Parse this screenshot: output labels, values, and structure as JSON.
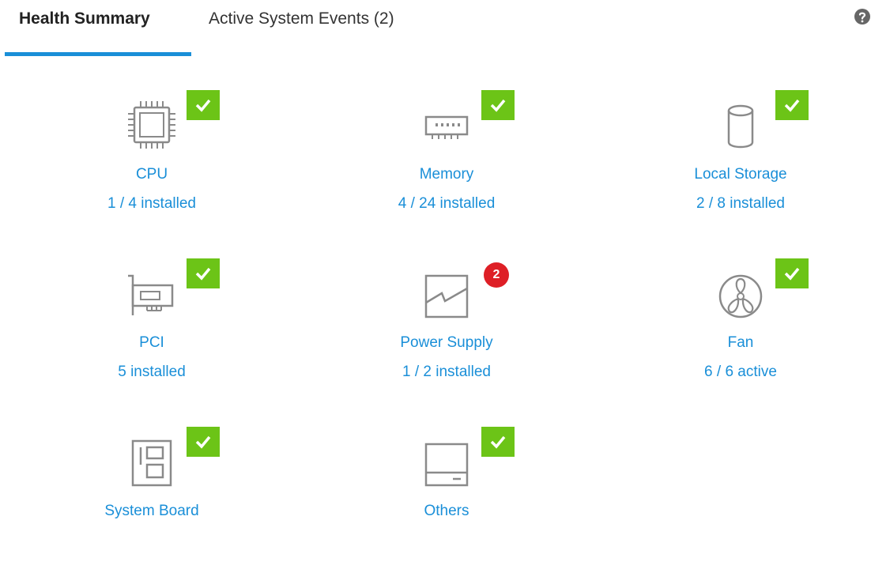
{
  "tabs": [
    {
      "label": "Health Summary",
      "active": true
    },
    {
      "label": "Active System Events (2)",
      "active": false
    }
  ],
  "help_icon": "question-circle-icon",
  "colors": {
    "accent": "#1a8fd8",
    "ok": "#6cc417",
    "error": "#de1f26",
    "icon_stroke": "#8a8a8a"
  },
  "components": [
    {
      "name": "CPU",
      "count": "1 / 4 installed",
      "icon": "cpu-chip-icon",
      "status": "ok"
    },
    {
      "name": "Memory",
      "count": "4 / 24 installed",
      "icon": "memory-module-icon",
      "status": "ok"
    },
    {
      "name": "Local Storage",
      "count": "2 / 8 installed",
      "icon": "storage-cylinder-icon",
      "status": "ok"
    },
    {
      "name": "PCI",
      "count": "5 installed",
      "icon": "pci-card-icon",
      "status": "ok"
    },
    {
      "name": "Power Supply",
      "count": "1 / 2 installed",
      "icon": "power-supply-icon",
      "status": "error",
      "error_count": "2"
    },
    {
      "name": "Fan",
      "count": "6 / 6 active",
      "icon": "fan-icon",
      "status": "ok"
    },
    {
      "name": "System Board",
      "count": "",
      "icon": "system-board-icon",
      "status": "ok"
    },
    {
      "name": "Others",
      "count": "",
      "icon": "others-device-icon",
      "status": "ok"
    }
  ]
}
